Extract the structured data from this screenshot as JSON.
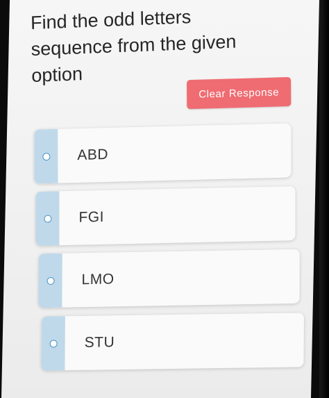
{
  "question": {
    "text": "Find the odd letters\nsequence from the given\noption"
  },
  "clear_response": {
    "label": "Clear Response",
    "color": "#ef6c72"
  },
  "options": [
    {
      "label": "ABD"
    },
    {
      "label": "FGI"
    },
    {
      "label": "LMO"
    },
    {
      "label": "STU"
    }
  ],
  "colors": {
    "radio_strip": "#bfd9ea",
    "radio_ring": "#4a93c6",
    "card_bg": "#fafafa"
  }
}
